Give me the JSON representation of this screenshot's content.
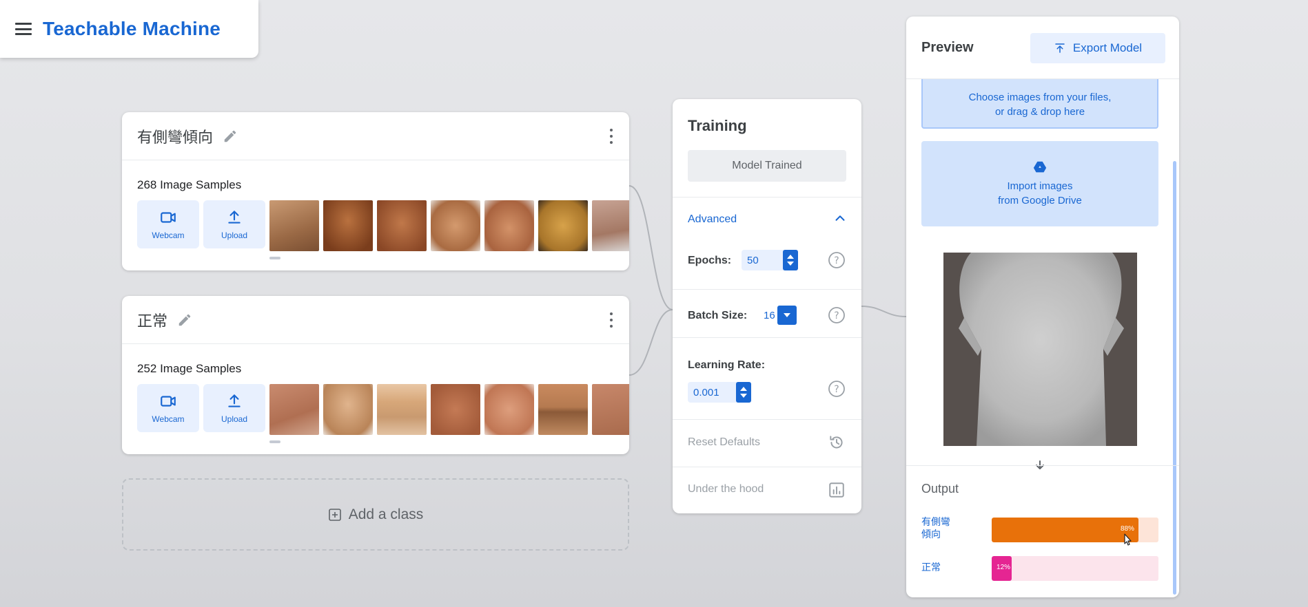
{
  "app": {
    "title": "Teachable Machine"
  },
  "classes": [
    {
      "name": "有側彎傾向",
      "samples_label": "268 Image Samples"
    },
    {
      "name": "正常",
      "samples_label": "252 Image Samples"
    }
  ],
  "class_tools": {
    "webcam_label": "Webcam",
    "upload_label": "Upload"
  },
  "add_class_label": "Add a class",
  "training": {
    "title": "Training",
    "status_button": "Model Trained",
    "advanced_label": "Advanced",
    "epochs_label": "Epochs:",
    "epochs_value": "50",
    "batch_label": "Batch Size:",
    "batch_value": "16",
    "lr_label": "Learning Rate:",
    "lr_value": "0.001",
    "reset_label": "Reset Defaults",
    "hood_label": "Under the hood"
  },
  "preview": {
    "title": "Preview",
    "export_label": "Export Model",
    "choose_line1": "Choose images from your files,",
    "choose_line2": "or drag & drop here",
    "drive_line1": "Import images",
    "drive_line2": "from Google Drive",
    "output_title": "Output",
    "outputs": [
      {
        "label_line1": "有側彎",
        "label_line2": "傾向",
        "percent": 88,
        "percent_text": "88%",
        "color": "#e8710a",
        "track": "#fde4d8"
      },
      {
        "label_line1": "正常",
        "label_line2": "",
        "percent": 12,
        "percent_text": "12%",
        "color": "#e52592",
        "track": "#fce4ec"
      }
    ]
  },
  "colors": {
    "accent": "#1967d2",
    "accent_light": "#e8f0fe"
  }
}
